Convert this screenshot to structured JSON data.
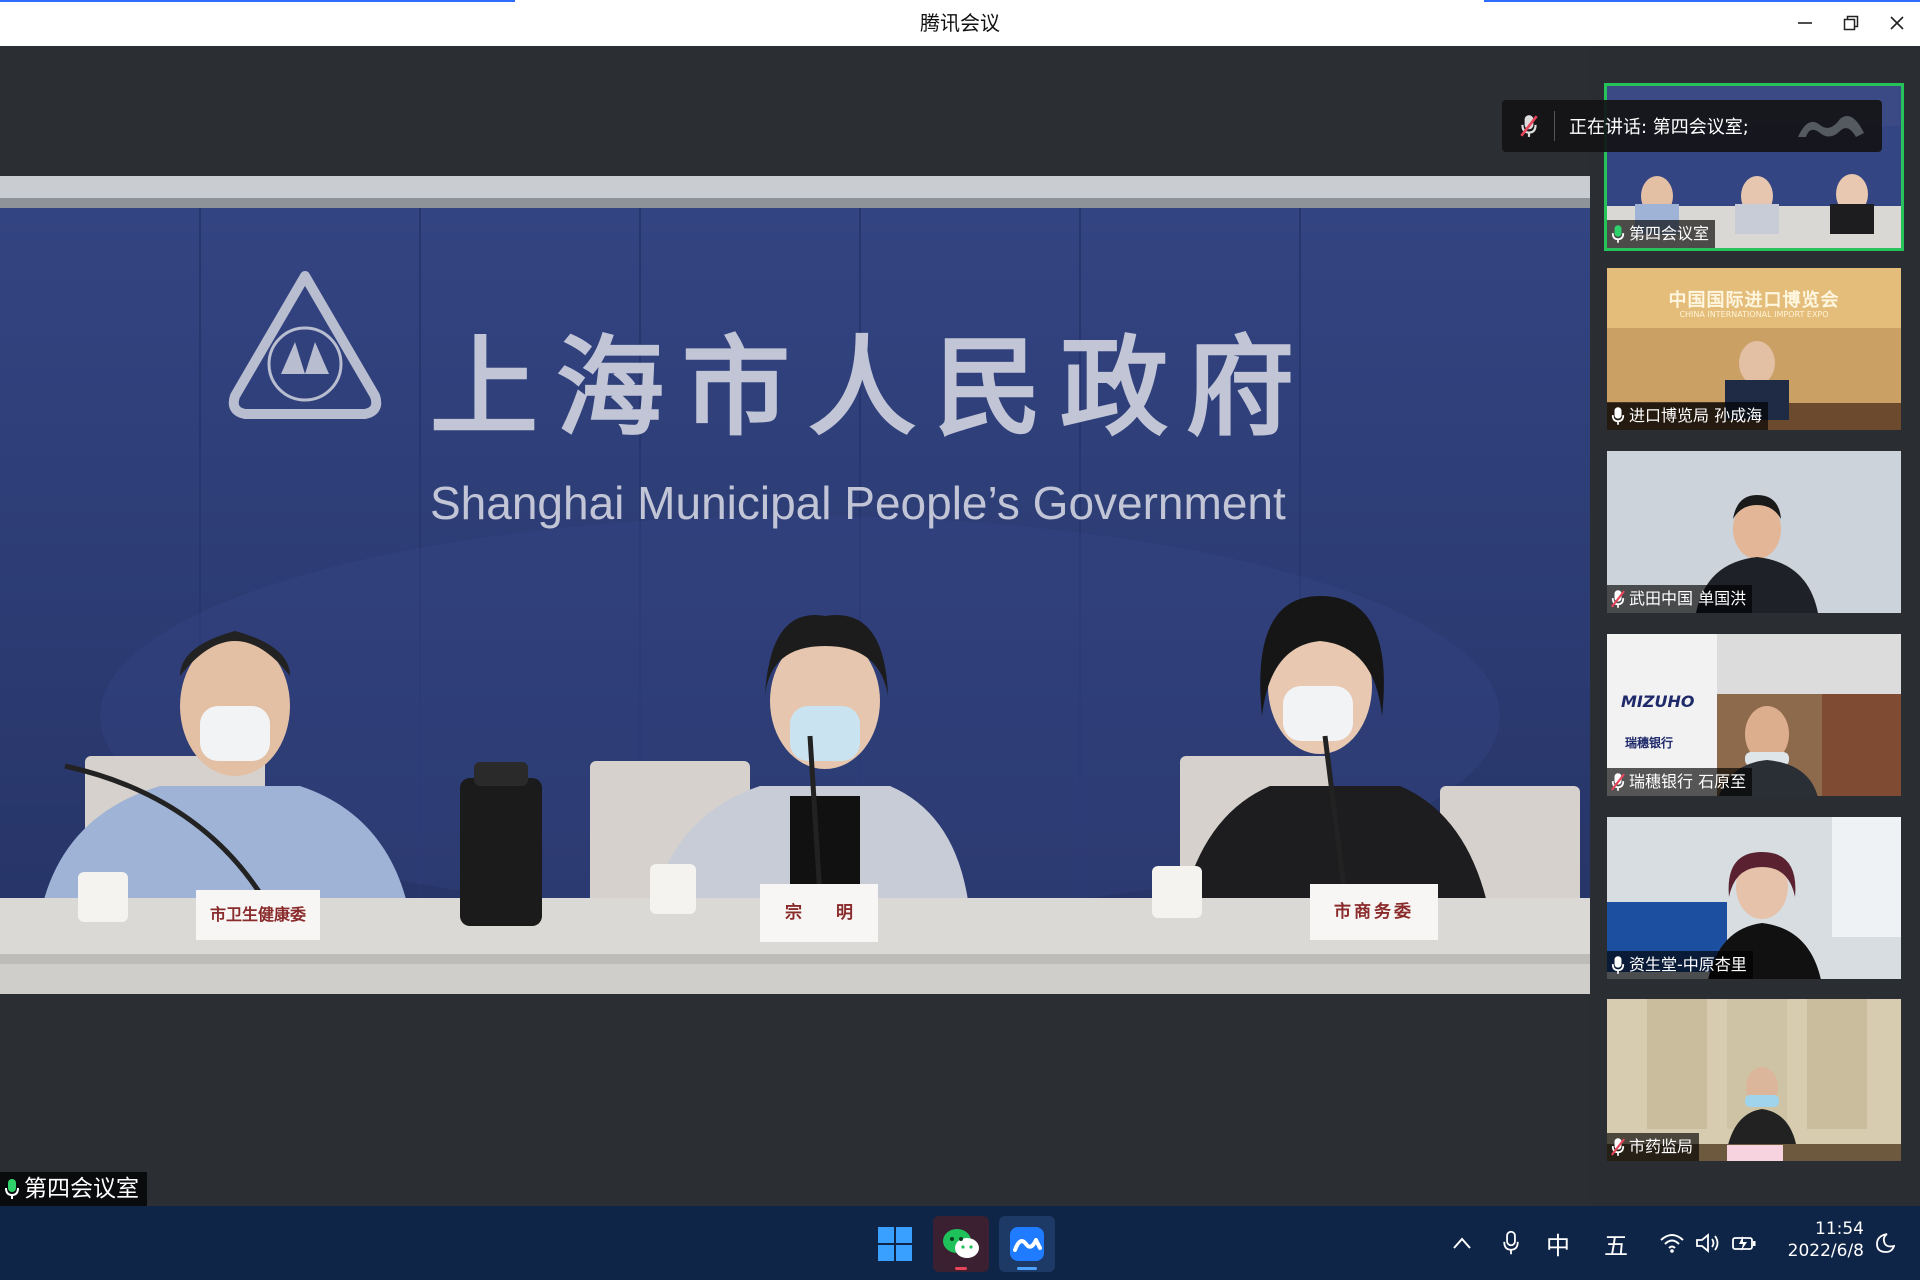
{
  "window": {
    "title": "腾讯会议"
  },
  "main_video": {
    "room_label": "第四会议室",
    "banner_cn": "上海市人民政府",
    "banner_en": "Shanghai Municipal People’s Government",
    "nameplates": [
      "市卫生健康委",
      "宗　　明",
      "市商务委"
    ]
  },
  "speaking": {
    "label": "正在讲话: 第四会议室;"
  },
  "participants": [
    {
      "name": "第四会议室",
      "mic": "on",
      "active": true
    },
    {
      "name": "进口博览局 孙成海",
      "mic": "on",
      "active": false,
      "sign": "中国国际进口博览会",
      "sign_en": "CHINA INTERNATIONAL IMPORT EXPO"
    },
    {
      "name": "武田中国 单国洪",
      "mic": "muted",
      "active": false
    },
    {
      "name": "瑞穗银行 石原至",
      "mic": "muted",
      "active": false,
      "brand": "MIZUHO",
      "brand_cn": "瑞穗银行"
    },
    {
      "name": "资生堂-中原杏里",
      "mic": "on",
      "active": false
    },
    {
      "name": "市药监局",
      "mic": "muted",
      "active": false
    }
  ],
  "taskbar": {
    "ime_lang": "中",
    "ime_mode": "五",
    "time": "11:54",
    "date": "2022/6/8"
  },
  "colors": {
    "title_bg": "#ffffff",
    "stage_bg": "#2b2f33",
    "active_border": "#26c25a",
    "taskbar_bg": "#0f2547",
    "backdrop_blue": "#2e3e7a"
  }
}
